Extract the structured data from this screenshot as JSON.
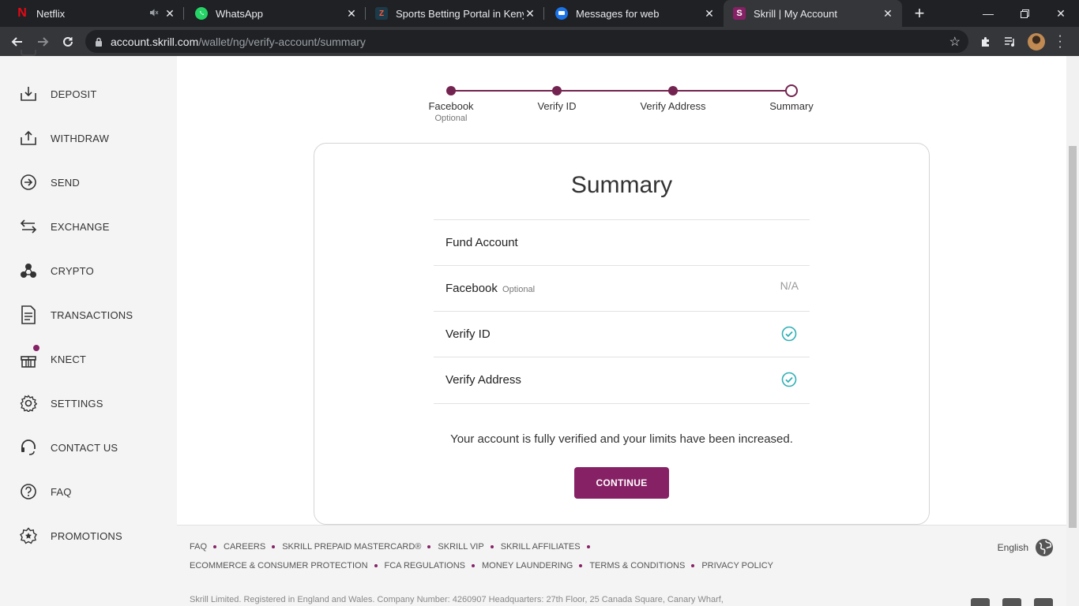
{
  "browser": {
    "tabs": [
      {
        "title": "Netflix",
        "icon": "netflix-icon",
        "muted": true
      },
      {
        "title": "WhatsApp",
        "icon": "whatsapp-icon"
      },
      {
        "title": "Sports Betting Portal in Kenya",
        "icon": "betting-icon"
      },
      {
        "title": "Messages for web",
        "icon": "messages-icon"
      },
      {
        "title": "Skrill | My Account",
        "icon": "skrill-icon",
        "active": true
      }
    ],
    "url_domain": "account.skrill.com",
    "url_path": "/wallet/ng/verify-account/summary"
  },
  "sidebar": {
    "items": [
      {
        "label": "DEPOSIT",
        "icon": "deposit-icon"
      },
      {
        "label": "WITHDRAW",
        "icon": "withdraw-icon"
      },
      {
        "label": "SEND",
        "icon": "send-icon"
      },
      {
        "label": "EXCHANGE",
        "icon": "exchange-icon"
      },
      {
        "label": "CRYPTO",
        "icon": "crypto-icon"
      },
      {
        "label": "TRANSACTIONS",
        "icon": "transactions-icon"
      },
      {
        "label": "KNECT",
        "icon": "gift-icon",
        "badge": true
      },
      {
        "label": "SETTINGS",
        "icon": "gear-icon"
      },
      {
        "label": "CONTACT US",
        "icon": "headset-icon"
      },
      {
        "label": "FAQ",
        "icon": "question-icon"
      },
      {
        "label": "PROMOTIONS",
        "icon": "star-badge-icon"
      }
    ]
  },
  "stepper": {
    "steps": [
      {
        "label": "Facebook",
        "sub": "Optional",
        "state": "done"
      },
      {
        "label": "Verify ID",
        "sub": "",
        "state": "done"
      },
      {
        "label": "Verify Address",
        "sub": "",
        "state": "done"
      },
      {
        "label": "Summary",
        "sub": "",
        "state": "current"
      }
    ]
  },
  "summary": {
    "title": "Summary",
    "rows": [
      {
        "label": "Fund Account",
        "optional": "",
        "value": "",
        "status": "none"
      },
      {
        "label": "Facebook",
        "optional": "Optional",
        "value": "N/A",
        "status": "na"
      },
      {
        "label": "Verify ID",
        "optional": "",
        "value": "",
        "status": "verified"
      },
      {
        "label": "Verify Address",
        "optional": "",
        "value": "",
        "status": "verified"
      }
    ],
    "message": "Your account is fully verified and your limits have been increased.",
    "continue_label": "CONTINUE"
  },
  "footer": {
    "links_row1": [
      "FAQ",
      "CAREERS",
      "SKRILL PREPAID MASTERCARD®",
      "SKRILL VIP",
      "SKRILL AFFILIATES"
    ],
    "links_row2": [
      "ECOMMERCE & CONSUMER PROTECTION",
      "FCA REGULATIONS",
      "MONEY LAUNDERING",
      "TERMS & CONDITIONS",
      "PRIVACY POLICY"
    ],
    "language": "English",
    "legal": "Skrill Limited. Registered in England and Wales. Company Number: 4260907 Headquarters: 27th Floor, 25 Canada Square, Canary Wharf,"
  },
  "colors": {
    "brand": "#862165",
    "stepper": "#73234f",
    "check": "#2fb0b5"
  }
}
